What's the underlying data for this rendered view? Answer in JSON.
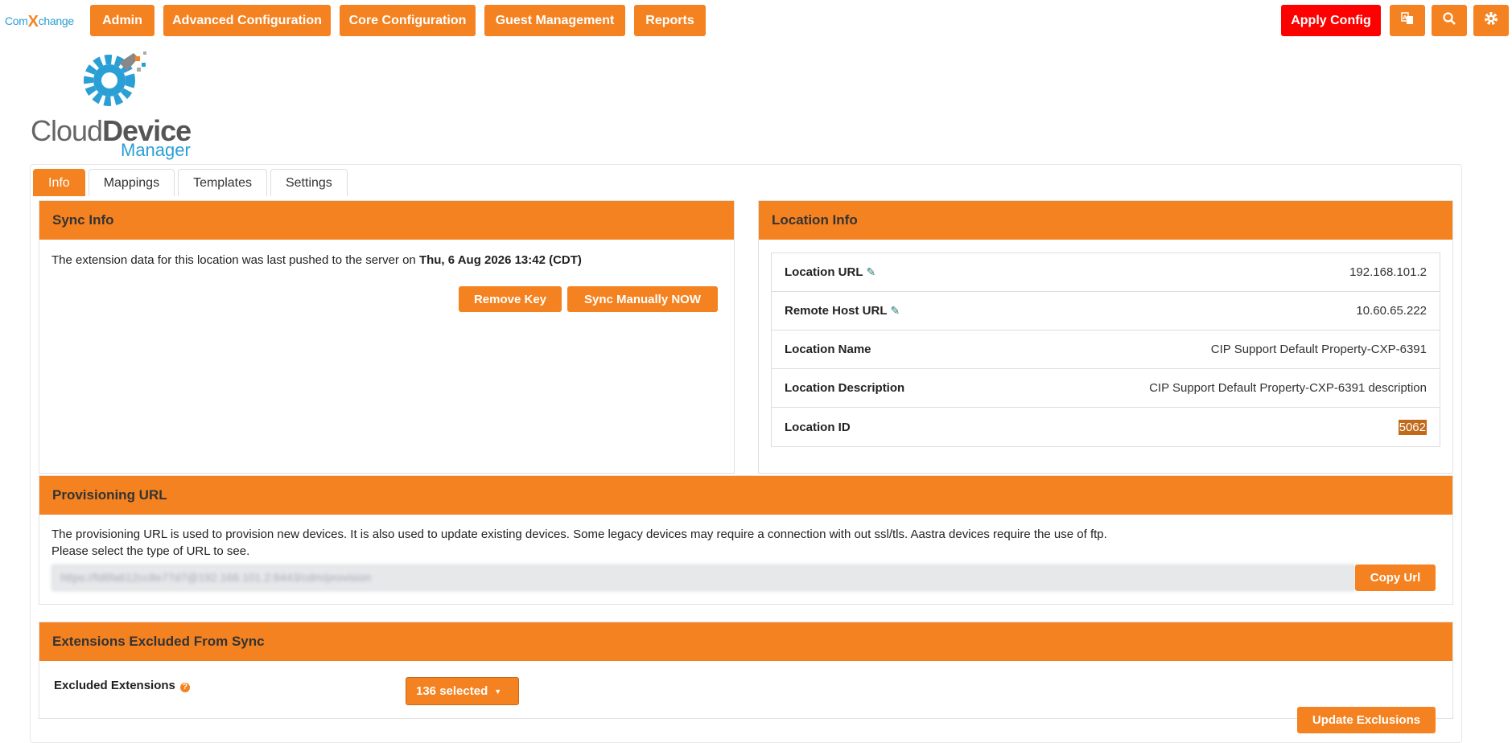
{
  "brand": {
    "prefix": "Com",
    "x": "X",
    "suffix": "change"
  },
  "nav": {
    "items": [
      "Admin",
      "Advanced Configuration",
      "Core Configuration",
      "Guest Management",
      "Reports"
    ],
    "apply_config": "Apply Config",
    "icons": [
      "translate-icon",
      "search-icon",
      "gear-icon"
    ]
  },
  "logo": {
    "word1_light": "Cloud",
    "word1_bold": "Device",
    "word2": "Manager"
  },
  "tabs": [
    "Info",
    "Mappings",
    "Templates",
    "Settings"
  ],
  "sync": {
    "title": "Sync Info",
    "message_prefix": "The extension data for this location was last pushed to the server on ",
    "message_date": "Thu, 6 Aug 2026 13:42 (CDT)",
    "remove_key": "Remove Key",
    "sync_now": "Sync Manually NOW"
  },
  "location": {
    "title": "Location Info",
    "rows": [
      {
        "label": "Location URL",
        "value": "192.168.101.2",
        "editable": true
      },
      {
        "label": "Remote Host URL",
        "value": "10.60.65.222",
        "editable": true
      },
      {
        "label": "Location Name",
        "value": "CIP Support Default Property-CXP-6391",
        "editable": false
      },
      {
        "label": "Location Description",
        "value": "CIP Support Default Property-CXP-6391 description",
        "editable": false
      },
      {
        "label": "Location ID",
        "value": "5062",
        "editable": false
      }
    ]
  },
  "provisioning": {
    "title": "Provisioning URL",
    "line1": "The provisioning URL is used to provision new devices. It is also used to update existing devices. Some legacy devices may require a connection with out ssl/tls. Aastra devices require the use of ftp.",
    "line2": "Please select the type of URL to see.",
    "url": "https://fd6fa612cc8e77d7@192.168.101.2:8443/cdm/provision",
    "copy": "Copy Url"
  },
  "exclusions": {
    "title": "Extensions Excluded From Sync",
    "label": "Excluded Extensions",
    "selected": "136 selected",
    "update": "Update Exclusions"
  },
  "colors": {
    "accent": "#f58220",
    "apply": "#ff0000",
    "brand_blue": "#2a9fd6"
  }
}
